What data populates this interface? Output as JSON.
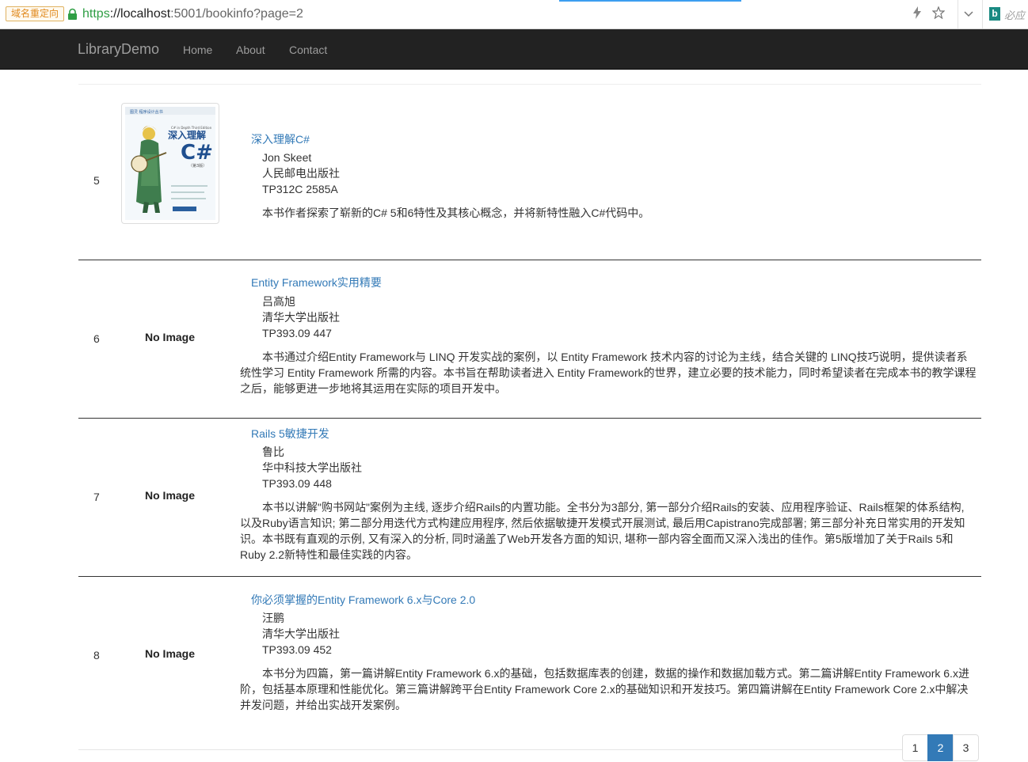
{
  "browser": {
    "redirect_badge": "域名重定向",
    "url_scheme": "https",
    "url_host": "://localhost",
    "url_path": ":5001/bookinfo?page=2",
    "search_engine_label": "必应",
    "search_engine_logo": "b"
  },
  "navbar": {
    "brand": "LibraryDemo",
    "links": [
      "Home",
      "About",
      "Contact"
    ]
  },
  "books": [
    {
      "number": "5",
      "has_cover": true,
      "title": "深入理解C#",
      "author": "Jon Skeet",
      "publisher": "人民邮电出版社",
      "call_number": "TP312C 2585A",
      "description": "本书作者探索了崭新的C# 5和6特性及其核心概念，并将新特性融入C#代码中。",
      "cover": {
        "series": "图灵 程序设计丛书",
        "title_cn": "深入理解",
        "title_big": "C#",
        "subtitle": "C# in Depth Third Edition",
        "edition": "（第3版）"
      }
    },
    {
      "number": "6",
      "has_cover": false,
      "no_image_label": "No Image",
      "title": "Entity Framework实用精要",
      "author": "吕高旭",
      "publisher": "清华大学出版社",
      "call_number": "TP393.09 447",
      "description": "本书通过介绍Entity Framework与 LINQ 开发实战的案例，以 Entity Framework 技术内容的讨论为主线，结合关键的 LINQ技巧说明，提供读者系统性学习 Entity Framework 所需的内容。本书旨在帮助读者进入 Entity Framework的世界，建立必要的技术能力，同时希望读者在完成本书的教学课程之后，能够更进一步地将其运用在实际的项目开发中。"
    },
    {
      "number": "7",
      "has_cover": false,
      "no_image_label": "No Image",
      "title": "Rails 5敏捷开发",
      "author": "鲁比",
      "publisher": "华中科技大学出版社",
      "call_number": "TP393.09 448",
      "description": "本书以讲解\"购书网站\"案例为主线, 逐步介绍Rails的内置功能。全书分为3部分, 第一部分介绍Rails的安装、应用程序验证、Rails框架的体系结构, 以及Ruby语言知识; 第二部分用迭代方式构建应用程序, 然后依据敏捷开发模式开展测试, 最后用Capistrano完成部署; 第三部分补充日常实用的开发知识。本书既有直观的示例, 又有深入的分析, 同时涵盖了Web开发各方面的知识, 堪称一部内容全面而又深入浅出的佳作。第5版增加了关于Rails 5和Ruby 2.2新特性和最佳实践的内容。"
    },
    {
      "number": "8",
      "has_cover": false,
      "no_image_label": "No Image",
      "title": "你必须掌握的Entity Framework 6.x与Core 2.0",
      "author": "汪鹏",
      "publisher": "清华大学出版社",
      "call_number": "TP393.09 452",
      "description": "本书分为四篇，第一篇讲解Entity Framework 6.x的基础，包括数据库表的创建，数据的操作和数据加载方式。第二篇讲解Entity Framework 6.x进阶，包括基本原理和性能优化。第三篇讲解跨平台Entity Framework Core 2.x的基础知识和开发技巧。第四篇讲解在Entity Framework Core 2.x中解决并发问题，并给出实战开发案例。"
    }
  ],
  "pagination": {
    "pages": [
      "1",
      "2",
      "3"
    ],
    "current": "2"
  },
  "colors": {
    "navbar_bg": "#222222",
    "link": "#337ab7",
    "active_page_bg": "#337ab7"
  }
}
